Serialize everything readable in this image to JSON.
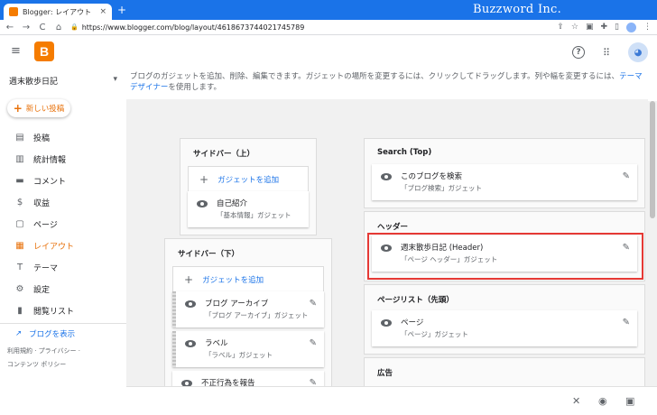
{
  "browser": {
    "tab_title": "Blogger: レイアウト",
    "tab_close": "×",
    "new_tab": "+",
    "brand": "Buzzword Inc.",
    "url": "https://www.blogger.com/blog/layout/4618673744021745789",
    "nav": [
      "←",
      "→",
      "C",
      "⌂"
    ],
    "icons": [
      "share-icon",
      "star-icon",
      "extension-icon",
      "puzzle-icon",
      "sidebar-icon",
      "profile-icon",
      "menu-icon"
    ]
  },
  "header": {
    "logo": "B",
    "help": "?",
    "apps": "⋮⋮"
  },
  "sidebar": {
    "blog_name": "週末散歩日記",
    "dropdown": "▾",
    "new_post": "新しい投稿",
    "items": [
      {
        "label": "投稿",
        "icon": "▤"
      },
      {
        "label": "統計情報",
        "icon": "▥"
      },
      {
        "label": "コメント",
        "icon": "▬"
      },
      {
        "label": "収益",
        "icon": "$"
      },
      {
        "label": "ページ",
        "icon": "▢"
      },
      {
        "label": "レイアウト",
        "icon": "▦"
      },
      {
        "label": "テーマ",
        "icon": "T"
      },
      {
        "label": "設定",
        "icon": "⚙"
      },
      {
        "label": "閲覧リスト",
        "icon": "▮"
      }
    ],
    "view_blog": "ブログを表示",
    "footer_line1": "利用規約 · プライバシー ·",
    "footer_line2": "コンテンツ ポリシー"
  },
  "main": {
    "desc_text": "ブログのガジェットを追加、削除、編集できます。ガジェットの場所を変更するには、クリックしてドラッグします。列や幅を変更するには、",
    "desc_link": "テーマ デザイナー",
    "desc_tail": "を使用します。",
    "add_gadget": "ガジェットを追加",
    "panels": {
      "sidebar_top": {
        "title": "サイドバー（上）",
        "gadgets": [
          {
            "name": "自己紹介",
            "sub": "「基本情報」ガジェット"
          }
        ]
      },
      "sidebar_bottom": {
        "title": "サイドバー（下）",
        "gadgets": [
          {
            "name": "ブログ アーカイブ",
            "sub": "「ブログ アーカイブ」ガジェット"
          },
          {
            "name": "ラベル",
            "sub": "「ラベル」ガジェット"
          },
          {
            "name": "不正行為を報告",
            "sub": ""
          }
        ]
      },
      "search": {
        "title": "Search (Top)",
        "gadgets": [
          {
            "name": "このブログを検索",
            "sub": "「ブログ検索」ガジェット"
          }
        ]
      },
      "header": {
        "title": "ヘッダー",
        "gadgets": [
          {
            "name": "週末散歩日記 (Header)",
            "sub": "「ページ ヘッダー」ガジェット"
          }
        ]
      },
      "pagelist": {
        "title": "ページリスト（先頭）",
        "gadgets": [
          {
            "name": "ページ",
            "sub": "「ページ」ガジェット"
          }
        ]
      },
      "ads": {
        "title": "広告"
      }
    }
  },
  "bottom": {
    "close": "✕",
    "preview": "◉",
    "save": "▣"
  },
  "colors": {
    "accent": "#e8710a",
    "link": "#1a73e8",
    "highlight": "#e53935"
  }
}
